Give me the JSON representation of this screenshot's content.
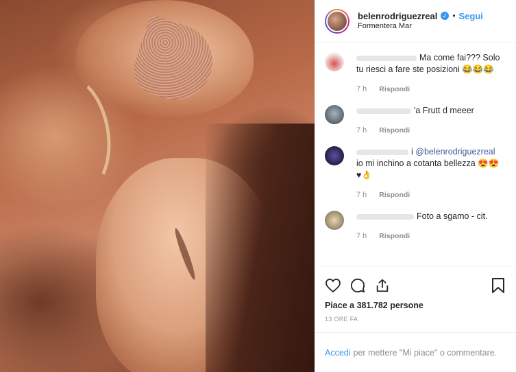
{
  "header": {
    "username": "belenrodriguezreal",
    "follow_label": "Segui",
    "location": "Formentera Mar",
    "separator": "•"
  },
  "comments": [
    {
      "name_hint": "",
      "text_prefix": "",
      "text": "Ma come fai??? Solo tu riesci a fare ste posizioni 😂😂😂",
      "time": "7 h",
      "reply": "Rispondi"
    },
    {
      "name_hint": "",
      "text_prefix": "",
      "text": "'a Frutt d meeer",
      "time": "7 h",
      "reply": "Rispondi"
    },
    {
      "name_hint": "i",
      "mention": "@belenrodriguezreal",
      "text": "io mi inchino a cotanta bellezza 😍😍 ♥👌",
      "time": "7 h",
      "reply": "Rispondi"
    },
    {
      "name_hint": "",
      "text_prefix": "",
      "text": "Foto a sgamo - cit.",
      "time": "7 h",
      "reply": "Rispondi"
    }
  ],
  "actions": {
    "likes_text": "Piace a 381.782 persone",
    "time_ago": "13 ORE FA"
  },
  "login_bar": {
    "link_text": "Accedi",
    "rest_text": "per mettere \"Mi piace\" o commentare."
  },
  "colors": {
    "accent": "#3897f0",
    "text": "#262626",
    "muted": "#8e8e8e"
  }
}
